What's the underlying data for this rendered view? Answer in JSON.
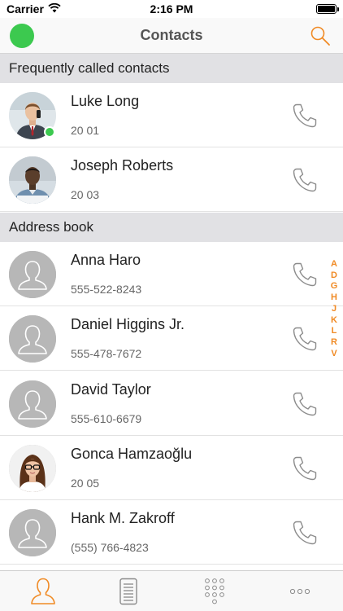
{
  "status_bar": {
    "carrier": "Carrier",
    "time": "2:16 PM"
  },
  "nav": {
    "title": "Contacts",
    "presence_color": "#3cc94f"
  },
  "accent_color": "#f08a24",
  "sections": {
    "frequent": {
      "title": "Frequently called contacts",
      "contacts": [
        {
          "name": "Luke Long",
          "number": "20 01",
          "avatar": "photo",
          "online": true
        },
        {
          "name": "Joseph Roberts",
          "number": "20 03",
          "avatar": "photo",
          "online": false
        }
      ]
    },
    "address_book": {
      "title": "Address book",
      "contacts": [
        {
          "name": "Anna Haro",
          "number": "555-522-8243",
          "avatar": "placeholder"
        },
        {
          "name": "Daniel Higgins Jr.",
          "number": "555-478-7672",
          "avatar": "placeholder"
        },
        {
          "name": "David Taylor",
          "number": "555-610-6679",
          "avatar": "placeholder"
        },
        {
          "name": "Gonca Hamzaoğlu",
          "number": "20 05",
          "avatar": "photo"
        },
        {
          "name": "Hank M. Zakroff",
          "number": "(555) 766-4823",
          "avatar": "placeholder"
        }
      ]
    }
  },
  "alpha_index": [
    "A",
    "D",
    "G",
    "H",
    "J",
    "K",
    "L",
    "R",
    "V"
  ],
  "tabs": [
    {
      "icon": "person-icon",
      "active": true
    },
    {
      "icon": "call-log-icon",
      "active": false
    },
    {
      "icon": "dialpad-icon",
      "active": false
    },
    {
      "icon": "more-icon",
      "active": false
    }
  ]
}
